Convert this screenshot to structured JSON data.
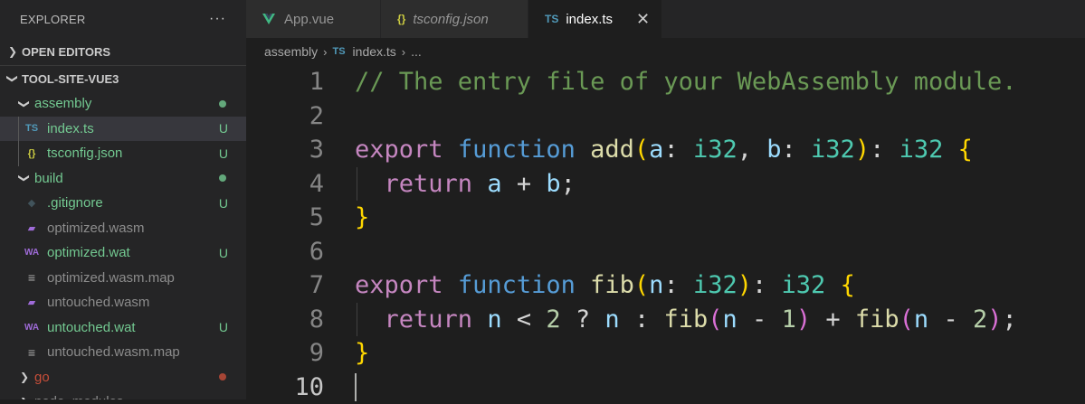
{
  "sidebar": {
    "title": "EXPLORER",
    "more": "···",
    "open_editors": "OPEN EDITORS",
    "workspace": "TOOL-SITE-VUE3",
    "items": [
      {
        "label": "assembly",
        "icon": "chevron-down-icon",
        "status": "dot",
        "depth": 1
      },
      {
        "label": "index.ts",
        "icon": "typescript-icon",
        "icon_text": "TS",
        "status": "U",
        "depth": 2
      },
      {
        "label": "tsconfig.json",
        "icon": "json-icon",
        "icon_text": "{}",
        "status": "U",
        "depth": 2
      },
      {
        "label": "build",
        "icon": "chevron-down-icon",
        "status": "dot",
        "depth": 1
      },
      {
        "label": ".gitignore",
        "icon": "git-icon",
        "icon_text": "◆",
        "status": "U",
        "depth": 2
      },
      {
        "label": "optimized.wasm",
        "icon": "wasm-icon",
        "icon_text": "▰",
        "status": "",
        "depth": 2
      },
      {
        "label": "optimized.wat",
        "icon": "wat-icon",
        "icon_text": "WA",
        "status": "U",
        "depth": 2
      },
      {
        "label": "optimized.wasm.map",
        "icon": "file-lines-icon",
        "icon_text": "≡",
        "status": "",
        "depth": 2
      },
      {
        "label": "untouched.wasm",
        "icon": "wasm-icon",
        "icon_text": "▰",
        "status": "",
        "depth": 2
      },
      {
        "label": "untouched.wat",
        "icon": "wat-icon",
        "icon_text": "WA",
        "status": "U",
        "depth": 2
      },
      {
        "label": "untouched.wasm.map",
        "icon": "file-lines-icon",
        "icon_text": "≡",
        "status": "",
        "depth": 2
      },
      {
        "label": "go",
        "icon": "chevron-right-icon",
        "status": "dot-red",
        "depth": 1
      },
      {
        "label": "node_modules",
        "icon": "chevron-right-icon",
        "status": "",
        "depth": 1
      }
    ],
    "colors": {
      "untracked": "#73c991",
      "modified_red": "#c74e39"
    }
  },
  "tabs": [
    {
      "label": "App.vue",
      "icon": "vue-icon"
    },
    {
      "label": "tsconfig.json",
      "icon": "json-icon",
      "icon_text": "{}"
    },
    {
      "label": "index.ts",
      "icon": "typescript-icon",
      "icon_text": "TS",
      "close": "✕"
    }
  ],
  "breadcrumb": {
    "folder": "assembly",
    "sep": "›",
    "file_icon": "TS",
    "file": "index.ts",
    "tail": "..."
  },
  "editor": {
    "line_numbers": [
      "1",
      "2",
      "3",
      "4",
      "5",
      "6",
      "7",
      "8",
      "9",
      "10"
    ],
    "l1": "// The entry file of your WebAssembly module.",
    "l3": {
      "kw": "export",
      "kw2": "function",
      "fn": "add",
      "p1": "(",
      "a": "a",
      "c1": ": ",
      "t1": "i32",
      "c2": ", ",
      "b": "b",
      "c3": ": ",
      "t2": "i32",
      "p2": ")",
      "c4": ": ",
      "t3": "i32",
      "brace": "{"
    },
    "l4": {
      "kw": "return",
      "a": "a",
      "op": " + ",
      "b": "b",
      "semi": ";"
    },
    "l5": "}",
    "l7": {
      "kw": "export",
      "kw2": "function",
      "fn": "fib",
      "p1": "(",
      "n": "n",
      "c1": ": ",
      "t1": "i32",
      "p2": ")",
      "c2": ": ",
      "t2": "i32",
      "brace": "{"
    },
    "l8": {
      "kw": "return",
      "n1": "n",
      "op1": " < ",
      "two": "2",
      "q": " ? ",
      "n2": "n",
      "colon": " : ",
      "fn1": "fib",
      "p1": "(",
      "n3": "n",
      "minus1": " - ",
      "one": "1",
      "p2": ")",
      "plus": " + ",
      "fn2": "fib",
      "p3": "(",
      "n4": "n",
      "minus2": " - ",
      "two2": "2",
      "p4": ")",
      "semi": ";"
    },
    "l9": "}"
  }
}
